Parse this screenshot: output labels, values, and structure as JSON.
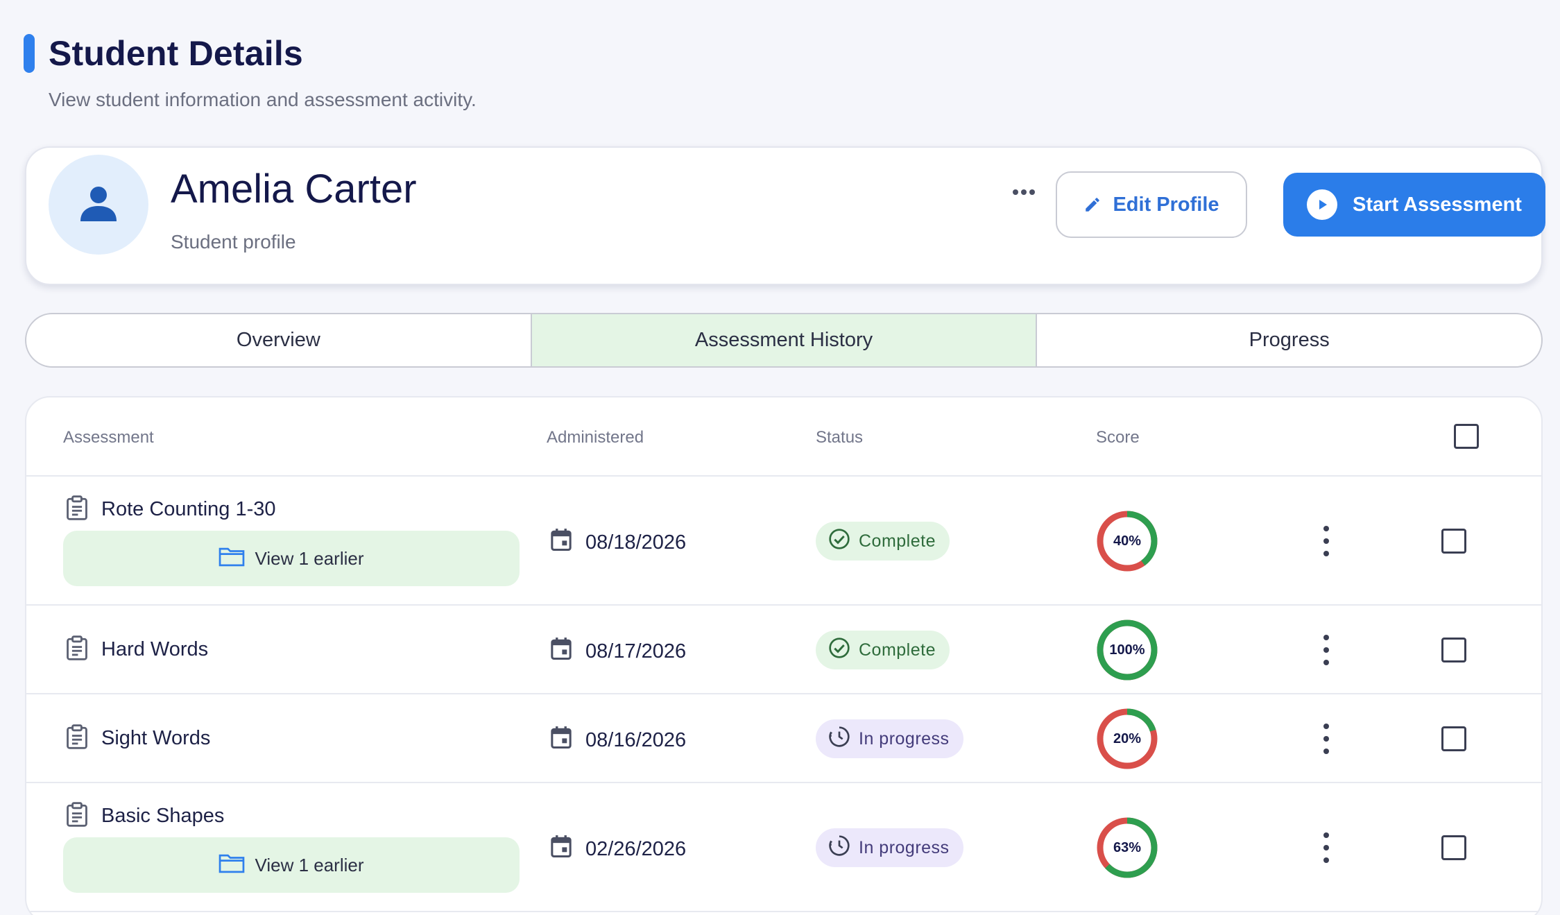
{
  "header": {
    "title": "Student Details",
    "subtitle": "View student information and assessment activity."
  },
  "profile": {
    "name": "Amelia Carter",
    "role": "Student profile",
    "edit_label": "Edit Profile",
    "start_label": "Start Assessment"
  },
  "tabs": [
    {
      "label": "Overview",
      "active": false
    },
    {
      "label": "Assessment History",
      "active": true
    },
    {
      "label": "Progress",
      "active": false
    }
  ],
  "table": {
    "columns": {
      "assessment": "Assessment",
      "administered": "Administered",
      "status": "Status",
      "score": "Score"
    },
    "rows": [
      {
        "name": "Rote Counting 1-30",
        "earlier": "View 1 earlier",
        "date": "08/18/2026",
        "status": "Complete",
        "status_type": "complete",
        "score": 40,
        "score_label": "40%"
      },
      {
        "name": "Hard Words",
        "earlier": "",
        "date": "08/17/2026",
        "status": "Complete",
        "status_type": "complete",
        "score": 100,
        "score_label": "100%"
      },
      {
        "name": "Sight Words",
        "earlier": "",
        "date": "08/16/2026",
        "status": "In progress",
        "status_type": "progress",
        "score": 20,
        "score_label": "20%"
      },
      {
        "name": "Basic Shapes",
        "earlier": "View 1 earlier",
        "date": "02/26/2026",
        "status": "In progress",
        "status_type": "progress",
        "score": 63,
        "score_label": "63%"
      }
    ]
  },
  "colors": {
    "accent": "#2b7de9",
    "score_good": "#2e9e4f",
    "score_bad": "#d94f4a",
    "tab_active": "#e4f5e5"
  },
  "icons": {
    "avatar": "person-icon",
    "edit": "pencil-icon",
    "start": "play-circle-icon",
    "assessment": "clipboard-icon",
    "date": "calendar-icon",
    "complete": "check-circle-icon",
    "progress": "clock-history-icon",
    "earlier": "folder-icon",
    "menu": "more-vertical-icon"
  }
}
